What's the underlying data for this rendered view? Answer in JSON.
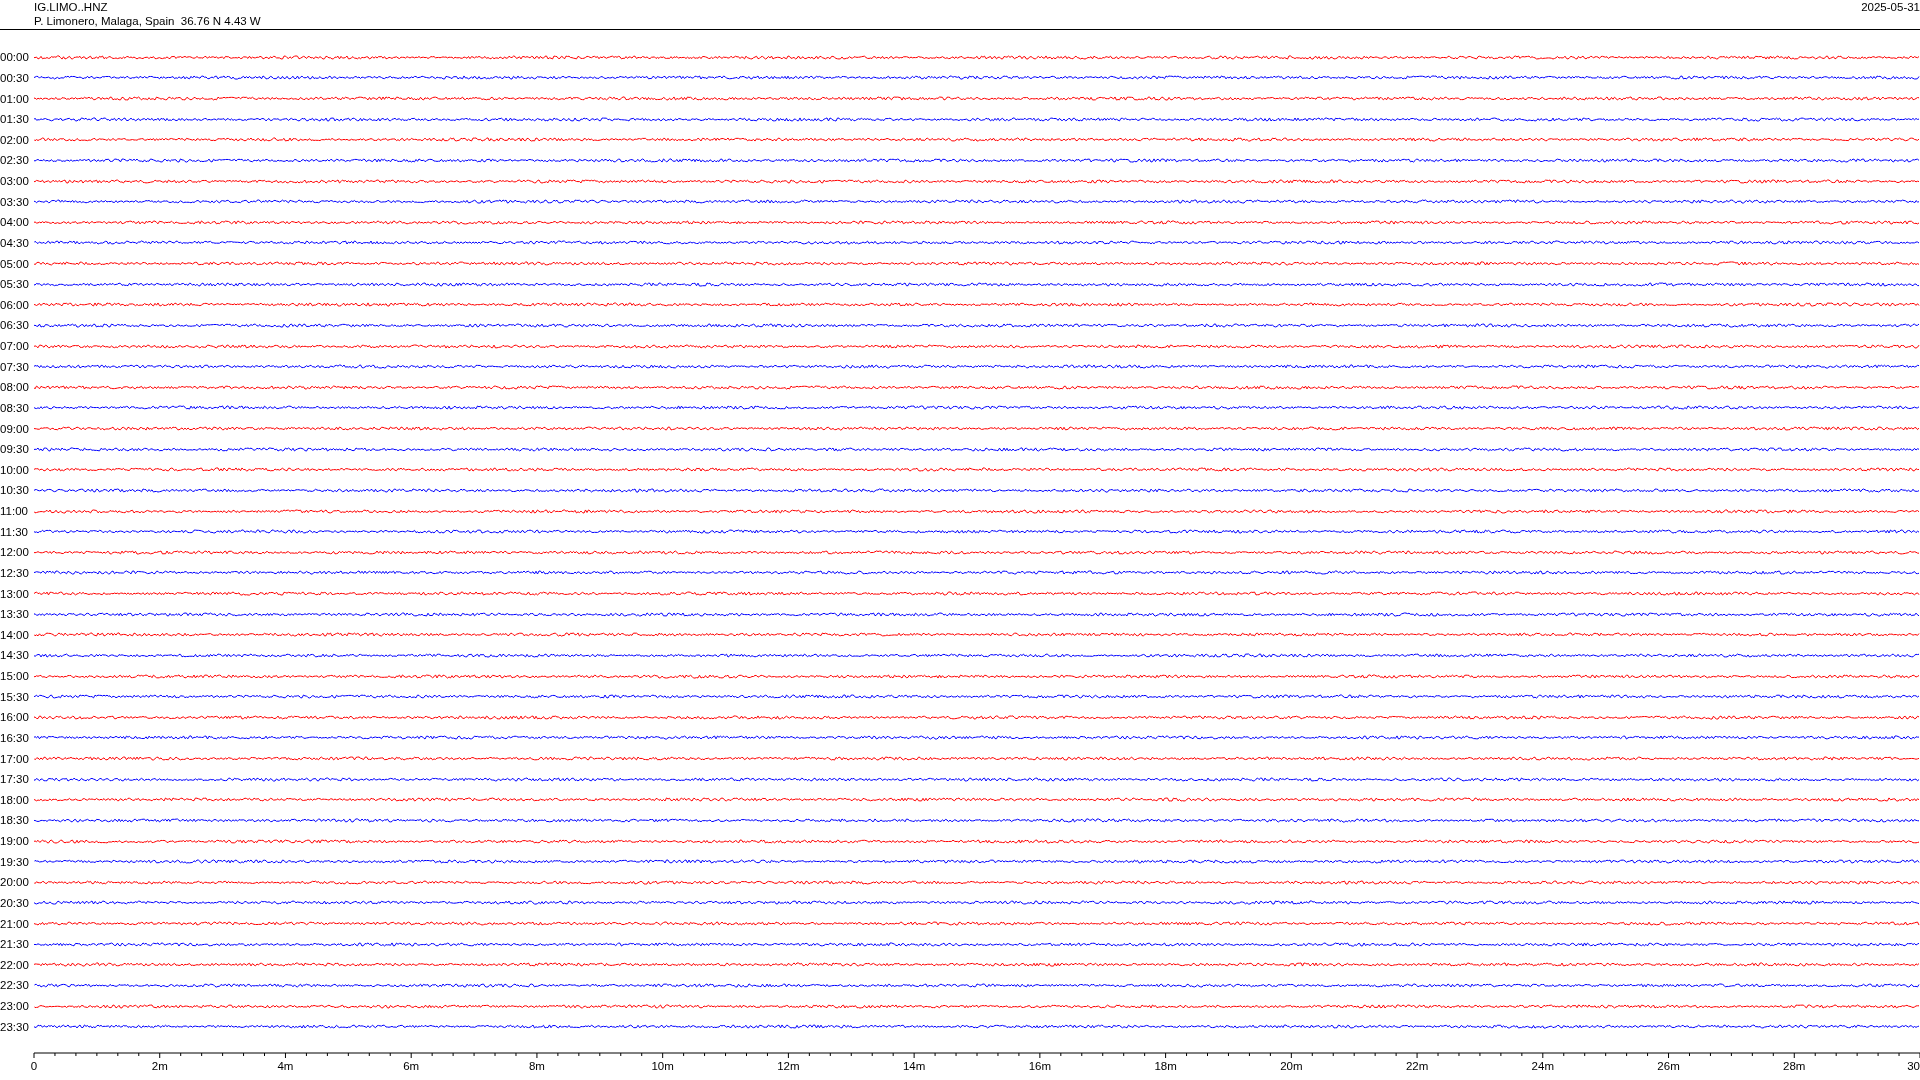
{
  "header": {
    "channel": "IG.LIMO..HNZ",
    "station": "P. Limonero, Malaga, Spain  36.76 N 4.43 W",
    "date": "2025-05-31"
  },
  "rows": [
    {
      "time": "00:00",
      "color": "#ff0000"
    },
    {
      "time": "00:30",
      "color": "#0000ff"
    },
    {
      "time": "01:00",
      "color": "#ff0000"
    },
    {
      "time": "01:30",
      "color": "#0000ff"
    },
    {
      "time": "02:00",
      "color": "#ff0000"
    },
    {
      "time": "02:30",
      "color": "#0000ff"
    },
    {
      "time": "03:00",
      "color": "#ff0000"
    },
    {
      "time": "03:30",
      "color": "#0000ff"
    },
    {
      "time": "04:00",
      "color": "#ff0000"
    },
    {
      "time": "04:30",
      "color": "#0000ff"
    },
    {
      "time": "05:00",
      "color": "#ff0000"
    },
    {
      "time": "05:30",
      "color": "#0000ff"
    },
    {
      "time": "06:00",
      "color": "#ff0000"
    },
    {
      "time": "06:30",
      "color": "#0000ff"
    },
    {
      "time": "07:00",
      "color": "#ff0000"
    },
    {
      "time": "07:30",
      "color": "#0000ff"
    },
    {
      "time": "08:00",
      "color": "#ff0000"
    },
    {
      "time": "08:30",
      "color": "#0000ff"
    },
    {
      "time": "09:00",
      "color": "#ff0000"
    },
    {
      "time": "09:30",
      "color": "#0000ff"
    },
    {
      "time": "10:00",
      "color": "#ff0000"
    },
    {
      "time": "10:30",
      "color": "#0000ff"
    },
    {
      "time": "11:00",
      "color": "#ff0000"
    },
    {
      "time": "11:30",
      "color": "#0000ff"
    },
    {
      "time": "12:00",
      "color": "#ff0000"
    },
    {
      "time": "12:30",
      "color": "#0000ff"
    },
    {
      "time": "13:00",
      "color": "#ff0000"
    },
    {
      "time": "13:30",
      "color": "#0000ff"
    },
    {
      "time": "14:00",
      "color": "#ff0000"
    },
    {
      "time": "14:30",
      "color": "#0000ff"
    },
    {
      "time": "15:00",
      "color": "#ff0000"
    },
    {
      "time": "15:30",
      "color": "#0000ff"
    },
    {
      "time": "16:00",
      "color": "#ff0000"
    },
    {
      "time": "16:30",
      "color": "#0000ff"
    },
    {
      "time": "17:00",
      "color": "#ff0000"
    },
    {
      "time": "17:30",
      "color": "#0000ff"
    },
    {
      "time": "18:00",
      "color": "#ff0000"
    },
    {
      "time": "18:30",
      "color": "#0000ff"
    },
    {
      "time": "19:00",
      "color": "#ff0000"
    },
    {
      "time": "19:30",
      "color": "#0000ff"
    },
    {
      "time": "20:00",
      "color": "#ff0000"
    },
    {
      "time": "20:30",
      "color": "#0000ff"
    },
    {
      "time": "21:00",
      "color": "#ff0000"
    },
    {
      "time": "21:30",
      "color": "#0000ff"
    },
    {
      "time": "22:00",
      "color": "#ff0000"
    },
    {
      "time": "22:30",
      "color": "#0000ff"
    },
    {
      "time": "23:00",
      "color": "#ff0000"
    },
    {
      "time": "23:30",
      "color": "#0000ff"
    }
  ],
  "axis": {
    "ticks": [
      "0",
      "2m",
      "4m",
      "6m",
      "8m",
      "10m",
      "12m",
      "14m",
      "16m",
      "18m",
      "20m",
      "22m",
      "24m",
      "26m",
      "28m",
      "30"
    ]
  }
}
